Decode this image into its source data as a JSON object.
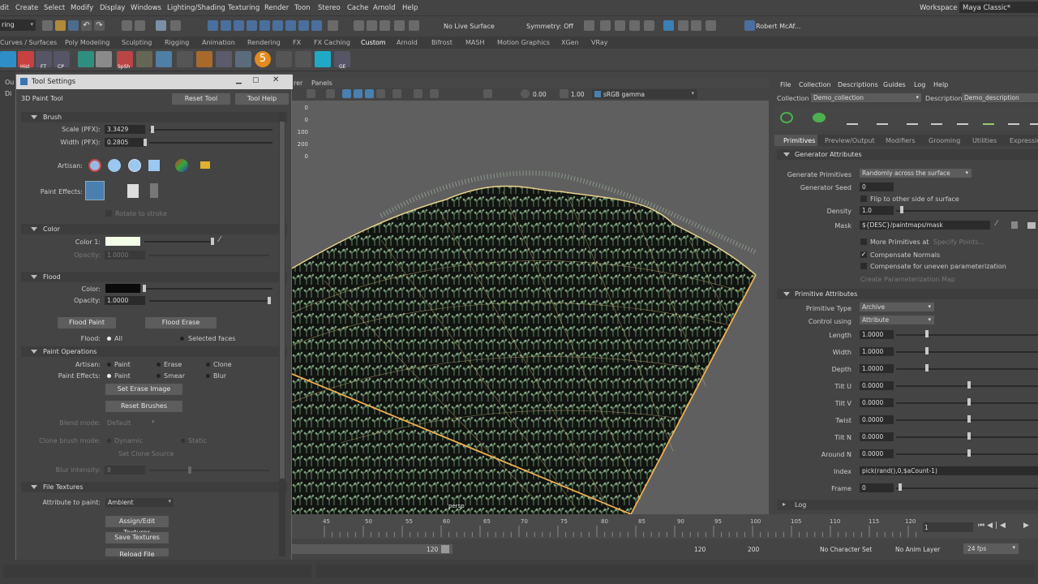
{
  "menubar": {
    "items": [
      "dit",
      "Create",
      "Select",
      "Modify",
      "Display",
      "Windows",
      "Lighting/Shading",
      "Texturing",
      "Render",
      "Toon",
      "Stereo",
      "Cache",
      "Arnold",
      "Help"
    ],
    "workspace_label": "Workspace :",
    "workspace_value": "Maya Classic*"
  },
  "statusline": {
    "mode": "ring",
    "live_surface": "No Live Surface",
    "symmetry": "Symmetry: Off",
    "user": "Robert McAf..."
  },
  "shelf": {
    "tabs": [
      "Curves / Surfaces",
      "Poly Modeling",
      "Sculpting",
      "Rigging",
      "Animation",
      "Rendering",
      "FX",
      "FX Caching",
      "Custom",
      "Arnold",
      "Bifrost",
      "MASH",
      "Motion Graphics",
      "XGen",
      "VRay"
    ],
    "active_tab": "Custom",
    "icon_labels": [
      "Hist",
      "FT",
      "CP",
      "SpSh",
      "GE"
    ]
  },
  "left_strip": {
    "labels": [
      "Ou",
      "Di"
    ]
  },
  "tool_settings": {
    "title": "Tool Settings",
    "tool_name": "3D Paint Tool",
    "reset_tool": "Reset Tool",
    "tool_help": "Tool Help",
    "brush": {
      "header": "Brush",
      "scale_label": "Scale (PFX):",
      "scale_value": "3.3429",
      "width_label": "Width (PFX):",
      "width_value": "0.2805",
      "artisan_label": "Artisan:",
      "paint_effects_label": "Paint Effects:",
      "rotate_to_stroke": "Rotate to stroke"
    },
    "color": {
      "header": "Color",
      "color1_label": "Color 1:",
      "opacity_label": "Opacity:",
      "opacity_value": "1.0000",
      "swatch": "#f4ffe8"
    },
    "flood": {
      "header": "Flood",
      "color_label": "Color:",
      "opacity_label": "Opacity:",
      "opacity_value": "1.0000",
      "flood_paint": "Flood Paint",
      "flood_erase": "Flood Erase",
      "flood_label": "Flood:",
      "opt_all": "All",
      "opt_selected": "Selected faces"
    },
    "paint_operations": {
      "header": "Paint Operations",
      "artisan_label": "Artisan:",
      "artisan_opts": [
        "Paint",
        "Erase",
        "Clone"
      ],
      "paint_effects_label": "Paint Effects:",
      "pfx_opts": [
        "Paint",
        "Smear",
        "Blur"
      ],
      "set_erase_image": "Set Erase Image",
      "reset_brushes": "Reset Brushes",
      "blend_mode_label": "Blend mode:",
      "blend_mode_value": "Default",
      "clone_brush_label": "Clone brush mode:",
      "clone_opts": [
        "Dynamic",
        "Static"
      ],
      "set_clone_source": "Set Clone Source",
      "blur_intensity_label": "Blur intensity:",
      "blur_intensity_value": "8"
    },
    "file_textures": {
      "header": "File Textures",
      "attribute_label": "Attribute to paint:",
      "attribute_value": "Ambient",
      "assign_edit": "Assign/Edit Textures",
      "save_textures": "Save Textures",
      "reload": "Reload File Textures"
    }
  },
  "viewport": {
    "menus": [
      "rer",
      "Panels"
    ],
    "exposure": "0.00",
    "gamma": "1.00",
    "color_space": "sRGB gamma",
    "hud_values": [
      "0",
      "0",
      "100",
      "200",
      "0"
    ],
    "camera_label": "persp"
  },
  "xgen": {
    "menus": [
      "File",
      "Collection",
      "Descriptions",
      "Guides",
      "Log",
      "Help"
    ],
    "collection_label": "Collection",
    "collection_value": "Demo_collection",
    "description_label": "Description",
    "description_value": "Demo_description",
    "tabs": [
      "Primitives",
      "Preview/Output",
      "Modifiers",
      "Grooming",
      "Utilities",
      "Expressio"
    ],
    "active_tab": "Primitives",
    "generator_header": "Generator Attributes",
    "generate_primitives_label": "Generate Primitives",
    "generate_primitives_value": "Randomly across the surface",
    "generator_seed_label": "Generator Seed",
    "generator_seed_value": "0",
    "flip_label": "Flip to other side of surface",
    "density_label": "Density",
    "density_value": "1.0",
    "mask_label": "Mask",
    "mask_value": "${DESC}/paintmaps/mask",
    "more_primitives": "More Primitives at",
    "specify_points": "Specify Points...",
    "compensate_normals": "Compensate Normals",
    "compensate_uneven": "Compensate for uneven parameterization",
    "create_param_map": "Create Parameterization Map",
    "primitive_header": "Primitive Attributes",
    "primitive_type_label": "Primitive Type",
    "primitive_type_value": "Archive",
    "control_using_label": "Control using",
    "control_using_value": "Attribute",
    "attrs": [
      {
        "label": "Length",
        "value": "1.0000"
      },
      {
        "label": "Width",
        "value": "1.0000"
      },
      {
        "label": "Depth",
        "value": "1.0000"
      },
      {
        "label": "Tilt U",
        "value": "0.0000"
      },
      {
        "label": "Tilt V",
        "value": "0.0000"
      },
      {
        "label": "Twist",
        "value": "0.0000"
      },
      {
        "label": "Tilt N",
        "value": "0.0000"
      },
      {
        "label": "Around N",
        "value": "0.0000"
      }
    ],
    "index_label": "Index",
    "index_value": "pick(rand(),0,$aCount-1)",
    "frame_label": "Frame",
    "frame_value": "0",
    "log_label": "Log"
  },
  "timeline": {
    "ticks": [
      "45",
      "50",
      "55",
      "60",
      "65",
      "70",
      "75",
      "80",
      "85",
      "90",
      "95",
      "100",
      "105",
      "110",
      "115",
      "120"
    ],
    "current_frame": "1",
    "range_end": "120",
    "anim_end": "120",
    "anim_max": "200",
    "character_set": "No Character Set",
    "anim_layer": "No Anim Layer",
    "fps": "24 fps"
  }
}
